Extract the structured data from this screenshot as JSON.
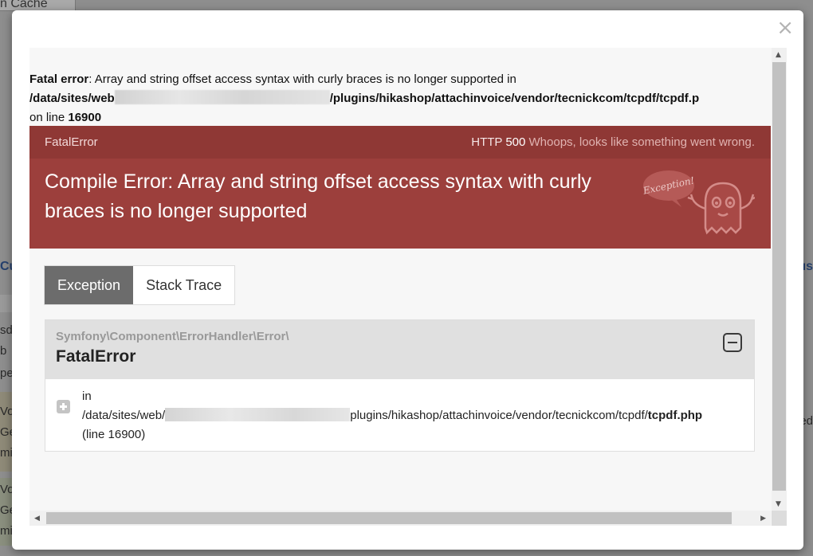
{
  "background": {
    "tab_fragment": "n Cache",
    "left_fragments": [
      "Cu",
      "sd",
      "b",
      "pe",
      "Vo",
      "Ge",
      "mi",
      "Vo",
      "Ge",
      "mi"
    ],
    "right_fragments": [
      "us",
      "ed"
    ]
  },
  "modal": {
    "close_glyph": "×"
  },
  "php_error": {
    "label": "Fatal error",
    "message": ": Array and string offset access syntax with curly braces is no longer supported in",
    "path_start": "/data/sites/web",
    "path_end": "/plugins/hikashop/attachinvoice/vendor/tecnickcom/tcpdf/tcpdf.p",
    "on_line_label": "on line ",
    "line_number": "16900"
  },
  "exception": {
    "name": "FatalError",
    "http_label": "HTTP ",
    "http_code": "500",
    "whoops": "Whoops, looks like something went wrong.",
    "message": "Compile Error: Array and string offset access syntax with curly braces is no longer supported",
    "ghost_bubble": "Exception!"
  },
  "tabs": [
    {
      "label": "Exception",
      "active": true
    },
    {
      "label": "Stack Trace",
      "active": false
    }
  ],
  "trace": {
    "namespace": "Symfony\\Component\\ErrorHandler\\Error\\",
    "class": "FatalError",
    "in_label": "in",
    "path_start": "/data/sites/web/",
    "path_mid": "plugins/hikashop/attachinvoice/vendor/tecnickcom/tcpdf/",
    "file": "tcpdf.php",
    "line": "(line 16900)"
  },
  "colors": {
    "header_red": "#9c3f3c",
    "header_top": "#8f3835",
    "active_tab": "#6c6c6c"
  }
}
